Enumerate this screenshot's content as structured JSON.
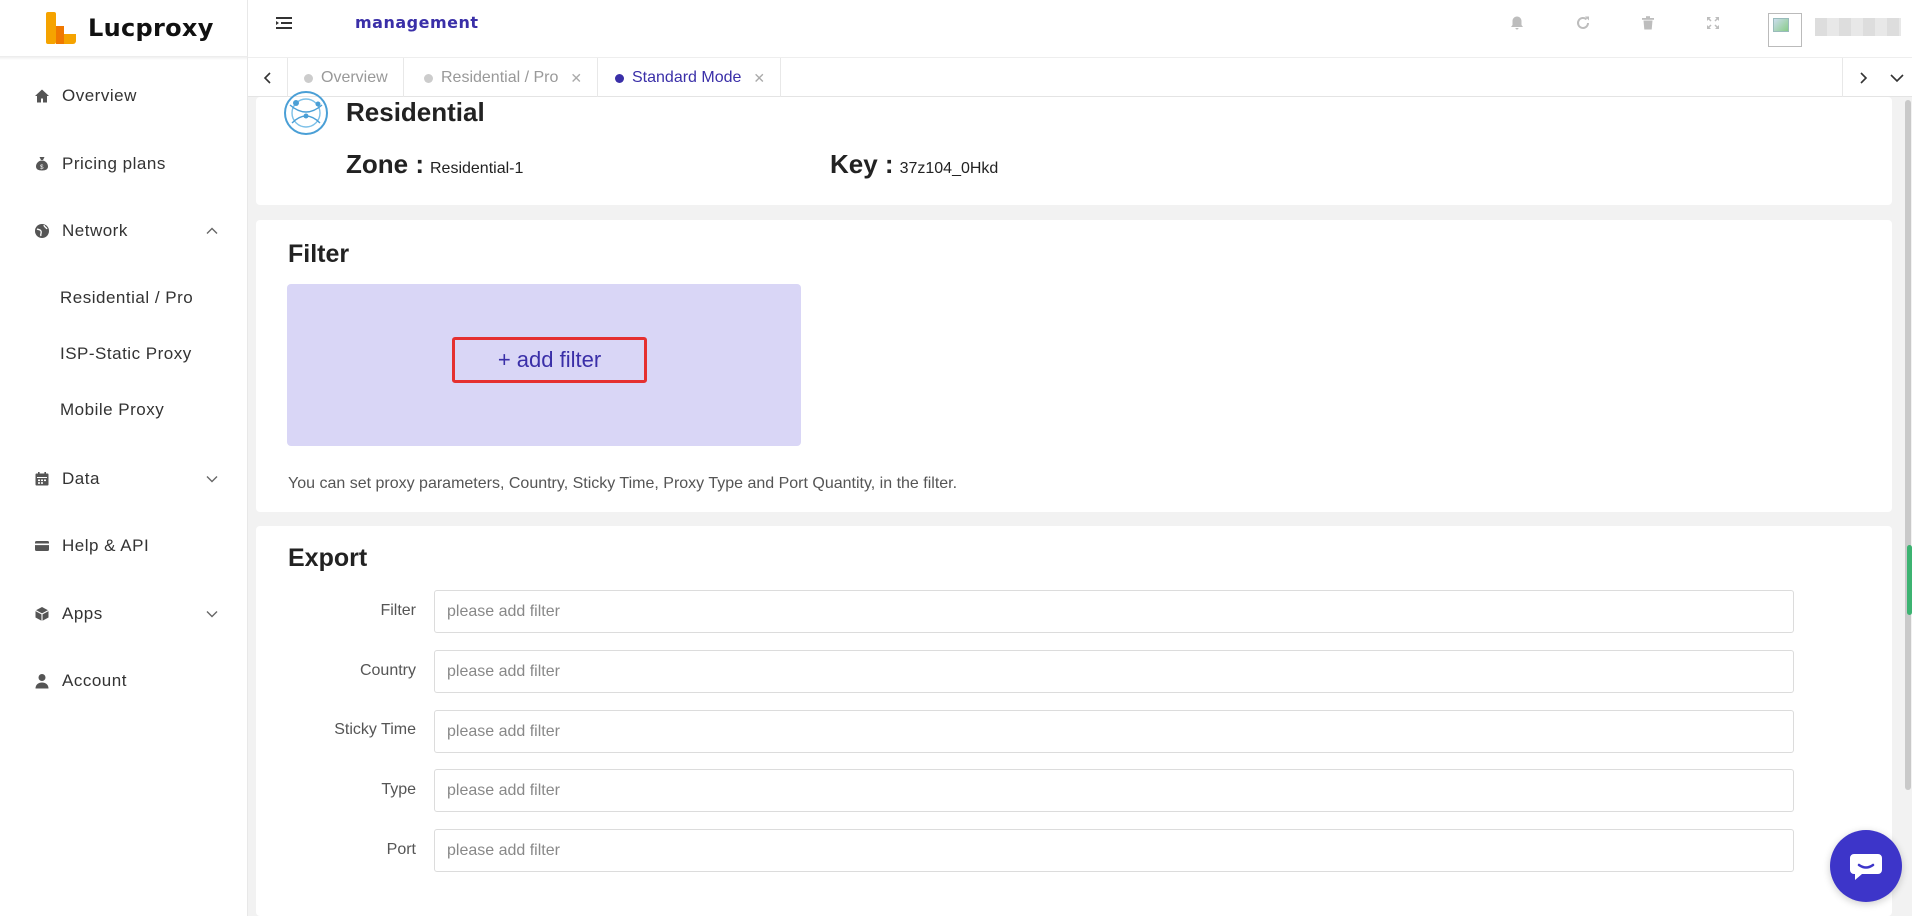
{
  "brand": {
    "name": "Lucproxy"
  },
  "header": {
    "title": "management"
  },
  "sidebar": {
    "items": [
      {
        "label": "Overview"
      },
      {
        "label": "Pricing plans"
      },
      {
        "label": "Network"
      },
      {
        "label": "Data"
      },
      {
        "label": "Help & API"
      },
      {
        "label": "Apps"
      },
      {
        "label": "Account"
      }
    ],
    "network_sub": [
      {
        "label": "Residential / Pro"
      },
      {
        "label": "ISP-Static Proxy"
      },
      {
        "label": "Mobile Proxy"
      }
    ]
  },
  "tabs": [
    {
      "label": "Overview"
    },
    {
      "label": "Residential / Pro"
    },
    {
      "label": "Standard Mode"
    }
  ],
  "zone_card": {
    "title": "Residential",
    "zone_label": "Zone :",
    "zone_value": "Residential-1",
    "key_label": "Key :",
    "key_value": "37z104_0Hkd"
  },
  "filter_section": {
    "title": "Filter",
    "add_button": "+ add filter",
    "hint": "You can set proxy parameters, Country, Sticky Time, Proxy Type and Port Quantity, in the filter."
  },
  "export_section": {
    "title": "Export",
    "rows": [
      {
        "label": "Filter",
        "placeholder": "please add filter"
      },
      {
        "label": "Country",
        "placeholder": "please add filter"
      },
      {
        "label": "Sticky Time",
        "placeholder": "please add filter"
      },
      {
        "label": "Type",
        "placeholder": "please add filter"
      },
      {
        "label": "Port",
        "placeholder": "please add filter"
      }
    ]
  },
  "colors": {
    "accent": "#3a2fa8",
    "filter_box": "#d9d6f6",
    "highlight": "#e53030",
    "chat": "#3d35c9"
  }
}
